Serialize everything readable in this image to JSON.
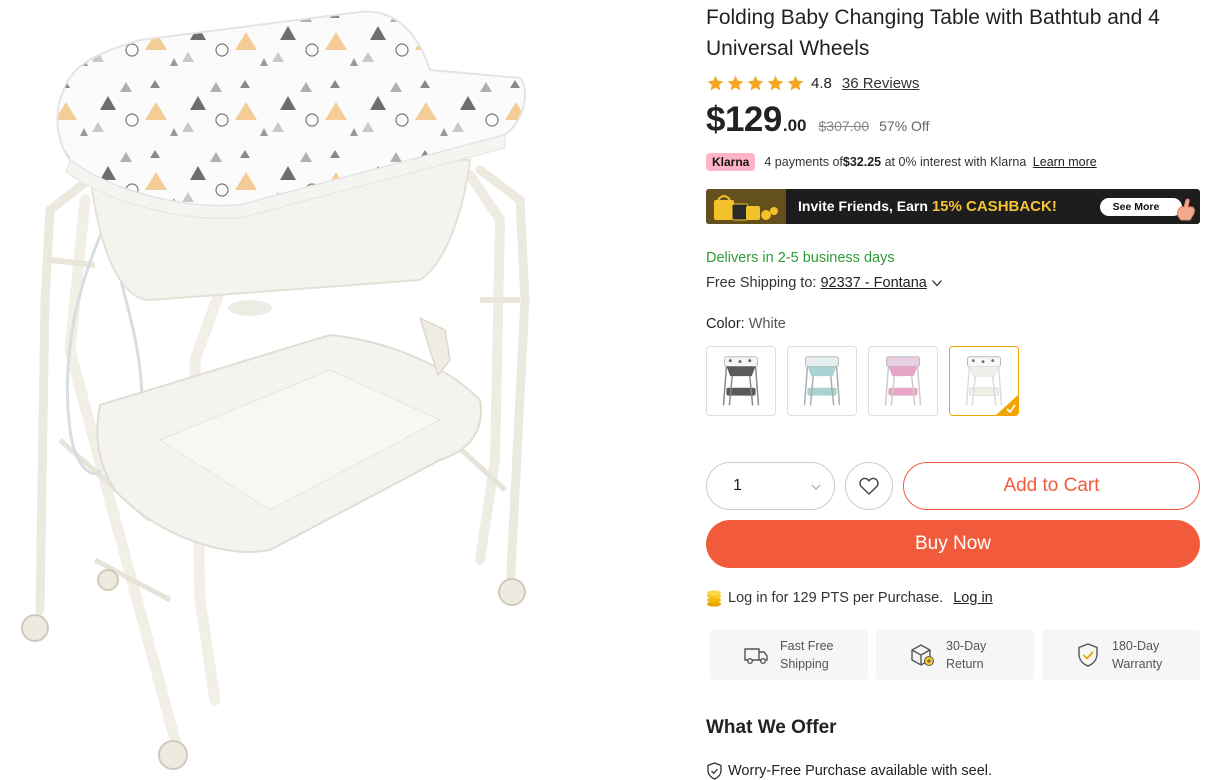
{
  "product": {
    "title_line1": "Folding Baby Changing Table with Bathtub and 4",
    "title_line2": "Universal Wheels",
    "image_alt_icon": "product-photo"
  },
  "rating": {
    "value": "4.8",
    "stars": 5,
    "reviews_label": "36 Reviews",
    "star_color": "#f5a623"
  },
  "price": {
    "main": "$129",
    "cents": ".00",
    "original": "$307.00",
    "discount": "57% Off"
  },
  "klarna": {
    "badge": "Klarna",
    "text_before": "4 payments of ",
    "amount": "$32.25",
    "text_after": " at 0% interest with Klarna ",
    "learn_more": "Learn more"
  },
  "promo_banner": {
    "text": "Invite Friends, Earn ",
    "highlight": "15% CASHBACK!",
    "button_label": "See More"
  },
  "delivery": {
    "text": "Delivers in 2-5 business days",
    "shipping_label": "Free Shipping to:",
    "shipping_location": "92337 - Fontana"
  },
  "color": {
    "label": "Color:",
    "selected": "White",
    "options": [
      "Gray",
      "Blue",
      "Pink",
      "White"
    ]
  },
  "cart": {
    "quantity": "1",
    "add_to_cart": "Add to Cart",
    "buy_now": "Buy Now"
  },
  "points": {
    "text": "Log in for 129 PTS per Purchase.",
    "login_label": "Log in"
  },
  "features": [
    {
      "line1": "Fast Free",
      "line2": "Shipping",
      "icon": "truck-icon"
    },
    {
      "line1": "30-Day",
      "line2": "Return",
      "icon": "return-box-icon"
    },
    {
      "line1": "180-Day",
      "line2": "Warranty",
      "icon": "shield-check-icon"
    }
  ],
  "offer": {
    "title": "What We Offer",
    "item1": "Worry-Free Purchase available with seel."
  },
  "colors": {
    "accent": "#f15a3b",
    "delivery_green": "#2e9d38",
    "klarna_pink": "#ffb3c7",
    "swatch_selected": "#f0a500"
  }
}
